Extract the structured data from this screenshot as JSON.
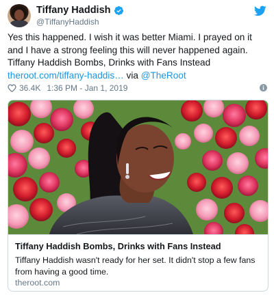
{
  "author": {
    "display_name": "Tiffany Haddish",
    "handle": "@TiffanyHaddish",
    "verified": true,
    "avatar_icon": "profile-photo"
  },
  "tweet": {
    "text_plain": "Yes this happened. I wish it was better Miami. I prayed on it and I have a strong feeling this will never happened again. Tiffany Haddish Bombs, Drinks with Fans Instead ",
    "link_text": "theroot.com/tiffany-haddis…",
    "via_text": " via ",
    "mention": "@TheRoot"
  },
  "meta": {
    "likes": "36.4K",
    "timestamp": "1:36 PM - Jan 1, 2019",
    "heart_icon": "heart-icon",
    "info_icon": "info-icon"
  },
  "card": {
    "title": "Tiffany Haddish Bombs, Drinks with Fans Instead",
    "description": "Tiffany Haddish wasn't ready for her set. It didn't stop a few fans from having a good time.",
    "domain": "theroot.com",
    "image_description_icon": "photo-woman-flower-wall"
  },
  "colors": {
    "link": "#1b95e0",
    "twitter_blue": "#1da1f2",
    "secondary_text": "#657786",
    "border": "#ccd6dd"
  }
}
